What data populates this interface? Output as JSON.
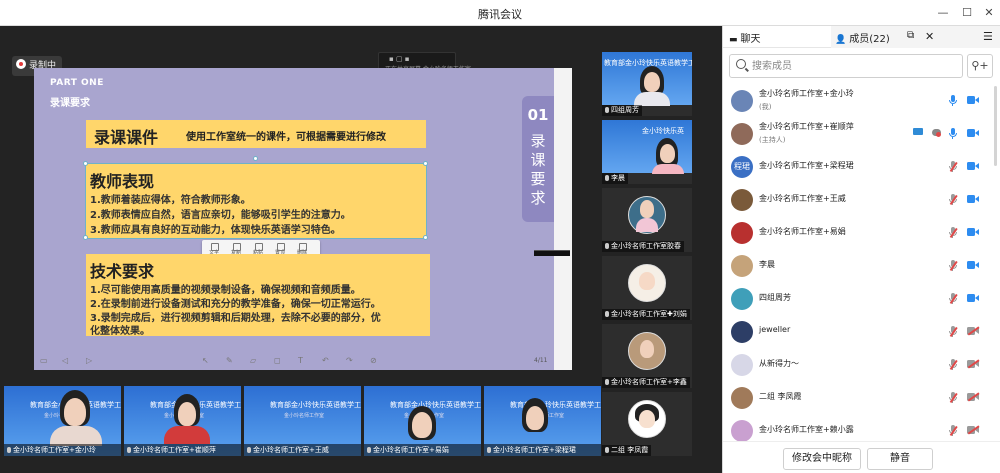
{
  "window": {
    "title": "腾讯会议"
  },
  "recording": {
    "label": "录制中"
  },
  "share_toolbar": {
    "line2": "正在共享屏幕 金小玲名师工作室"
  },
  "slide": {
    "part": "PART ONE",
    "title": "录课要求",
    "tab_number": "01",
    "tab_text": [
      "录",
      "课",
      "要",
      "求"
    ],
    "box1": {
      "heading": "录课课件",
      "subtitle": "使用工作室统一的课件，可根据需要进行修改"
    },
    "box2": {
      "heading": "教师表现",
      "lines": [
        "1.教师着装应得体，符合教师形象。",
        "2.教师表情应自然，语言应亲切，能够吸引学生的注意力。",
        "3.教师应具有良好的互动能力，体现快乐英语学习特色。"
      ]
    },
    "box3": {
      "heading": "技术要求",
      "lines": [
        "1.尽可能使用高质量的视频录制设备，确保视频和音频质量。",
        "2.在录制前进行设备测试和充分的教学准备，确保一切正常运行。",
        "3.录制完成后，进行视频剪辑和后期处理，去除不必要的部分，优",
        "化整体效果。"
      ]
    },
    "mini_toolbar": [
      "文字",
      "复制",
      "粘贴",
      "置顶",
      "删除"
    ],
    "page": "4/11"
  },
  "right_strip": [
    {
      "label": "四组周芳",
      "bg_text": "教育部金小玲快乐英语教学工作室"
    },
    {
      "label": "李晨",
      "bg_text": "金小玲快乐英"
    },
    {
      "label": "金小玲名师工作室胶春",
      "bg_text": ""
    },
    {
      "label": "金小玲名师工作室✚刘娟",
      "bg_text": ""
    },
    {
      "label": "金小玲名师工作室+李鑫",
      "bg_text": ""
    },
    {
      "label": "二组 李凤霞",
      "bg_text": ""
    }
  ],
  "bottom_strip": [
    {
      "label": "金小玲名师工作室+金小玲",
      "bg_text": "教育部金小玲快乐英语教学工作室",
      "small": "金小玲名师工作室"
    },
    {
      "label": "金小玲名师工作室+崔顺萍",
      "bg_text": "教育部金小玲快乐英语教学工作室",
      "small": "金小玲名师工作室"
    },
    {
      "label": "金小玲名师工作室+王威",
      "bg_text": "教育部金小玲快乐英语教学工作室",
      "small": "金小玲名师工作室"
    },
    {
      "label": "金小玲名师工作室+易娟",
      "bg_text": "教育部金小玲快乐英语教学工作室",
      "small": "金小玲名师工作室"
    },
    {
      "label": "金小玲名师工作室+梁程珺",
      "bg_text": "教育部金小玲快乐英语教学工作室",
      "small": "金小玲名师工作室"
    }
  ],
  "panel": {
    "tab_chat": "聊天",
    "tab_members": "成员(22)",
    "search_placeholder": "搜索成员",
    "members": [
      {
        "name": "金小玲名师工作室+金小玲",
        "role": "(我)",
        "avatar": "",
        "mic": "on",
        "cam": "on"
      },
      {
        "name": "金小玲名师工作室+崔顺萍",
        "role": "(主持人)",
        "avatar": "",
        "mic": "on",
        "cam": "on",
        "extras": true
      },
      {
        "name": "金小玲名师工作室+梁程珺",
        "role": "",
        "avatar": "程珺",
        "mic": "off",
        "cam": "on"
      },
      {
        "name": "金小玲名师工作室+王威",
        "role": "",
        "avatar": "",
        "mic": "off",
        "cam": "on"
      },
      {
        "name": "金小玲名师工作室+易娟",
        "role": "",
        "avatar": "",
        "mic": "off",
        "cam": "on"
      },
      {
        "name": "李晨",
        "role": "",
        "avatar": "",
        "mic": "off",
        "cam": "on"
      },
      {
        "name": "四组周芳",
        "role": "",
        "avatar": "",
        "mic": "off",
        "cam": "on"
      },
      {
        "name": "jeweller",
        "role": "",
        "avatar": "",
        "mic": "off",
        "cam": "off"
      },
      {
        "name": "从新得力～",
        "role": "",
        "avatar": "",
        "mic": "off",
        "cam": "off"
      },
      {
        "name": "二组 李凤霞",
        "role": "",
        "avatar": "",
        "mic": "off",
        "cam": "off"
      },
      {
        "name": "金小玲名师工作室+赖小露",
        "role": "",
        "avatar": "",
        "mic": "off",
        "cam": "off"
      }
    ],
    "rename_button": "修改会中昵称",
    "mute_button": "静音"
  },
  "colors": {
    "accent": "#1e6fff",
    "muted": "#e04848",
    "active_speaker": "#3fbf6a",
    "slide_bg": "#a9a5cf",
    "box": "#ffd66b"
  }
}
